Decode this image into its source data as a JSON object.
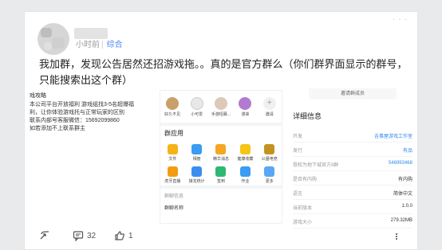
{
  "post": {
    "time": "小时前",
    "category": "综合",
    "content": "我加群，发现公告居然还招游戏拖。。真的是官方群么（你们群界面显示的群号，只能搜索出这个群）",
    "more_icon": "more-icon"
  },
  "screenshot": {
    "left_panel": {
      "title": "戏攻略",
      "lines": [
        "本公司平台开放福利 游戏组找3-5名超爆福",
        "利，让你体验游戏托与正常玩家的区别",
        "联系内部号客服微信：15692099860",
        "如若添加不上联系群主"
      ]
    },
    "mid_panel": {
      "members": [
        "好久不见",
        "小可爱",
        "手游招募...",
        "漫柒",
        "邀请"
      ],
      "section_title": "群应用",
      "apps": [
        {
          "label": "文件",
          "color": "#f5b316"
        },
        {
          "label": "相册",
          "color": "#3a9cf2"
        },
        {
          "label": "精华消息",
          "color": "#f5a623"
        },
        {
          "label": "健康收藏",
          "color": "#f5c518"
        },
        {
          "label": "公墓电竞",
          "color": "#c4931f"
        },
        {
          "label": "虎牙直播",
          "color": "#f39c12"
        },
        {
          "label": "接龙统计",
          "color": "#3b8ef0"
        },
        {
          "label": "签到",
          "color": "#2eb872"
        },
        {
          "label": "作业",
          "color": "#3a9cf2"
        },
        {
          "label": "更多",
          "color": "#5aa7f5"
        }
      ],
      "more_text": "群聊信息",
      "bottom_text": "群聊名称"
    },
    "right_panel": {
      "header": "邀请群成员",
      "title": "详细信息",
      "rows": [
        {
          "k": "开发",
          "v": "吉事屋游戏工作室",
          "link": true
        },
        {
          "k": "发行",
          "v": "有品",
          "link": true
        },
        {
          "k": "授权为地下城官方9群",
          "v": "546993468",
          "link": true
        },
        {
          "k": "是否有内购",
          "v": "有内购",
          "link": false
        },
        {
          "k": "语言",
          "v": "简体中文",
          "link": false
        },
        {
          "k": "当前版本",
          "v": "1.0.0",
          "link": false
        },
        {
          "k": "游戏大小",
          "v": "279.32MB",
          "link": false
        }
      ]
    }
  },
  "actions": {
    "share_icon": "share-icon",
    "comment_count": "32",
    "like_count": "1",
    "more_icon": "more-vertical-icon"
  }
}
